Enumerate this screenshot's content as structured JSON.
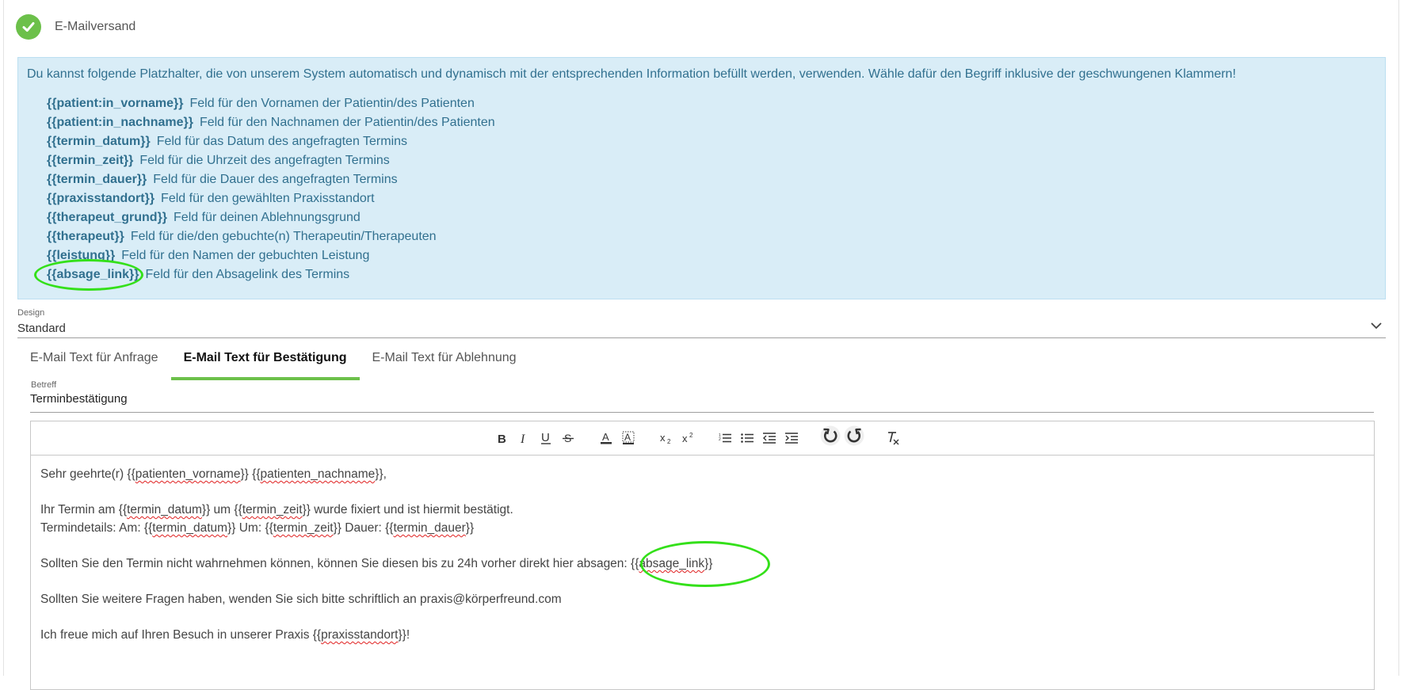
{
  "header": {
    "title": "E-Mailversand"
  },
  "info": {
    "intro": "Du kannst folgende Platzhalter, die von unserem System automatisch und dynamisch mit der entsprechenden Information befüllt werden, verwenden. Wähle dafür den Begriff inklusive der geschwungenen Klammern!",
    "placeholders": [
      {
        "key": "{{patient:in_vorname}}",
        "desc": "Feld für den Vornamen der Patientin/des Patienten"
      },
      {
        "key": "{{patient:in_nachname}}",
        "desc": "Feld für den Nachnamen der Patientin/des Patienten"
      },
      {
        "key": "{{termin_datum}}",
        "desc": "Feld für das Datum des angefragten Termins"
      },
      {
        "key": "{{termin_zeit}}",
        "desc": "Feld für die Uhrzeit des angefragten Termins"
      },
      {
        "key": "{{termin_dauer}}",
        "desc": "Feld für die Dauer des angefragten Termins"
      },
      {
        "key": "{{praxisstandort}}",
        "desc": "Feld für den gewählten Praxisstandort"
      },
      {
        "key": "{{therapeut_grund}}",
        "desc": "Feld für deinen Ablehnungsgrund"
      },
      {
        "key": "{{therapeut}}",
        "desc": "Feld für die/den gebuchte(n) Therapeutin/Therapeuten"
      },
      {
        "key": "{{leistung}}",
        "desc": "Feld für den Namen der gebuchten Leistung"
      },
      {
        "key": "{{absage_link}}",
        "desc": "Feld für den Absagelink des Termins"
      }
    ]
  },
  "design": {
    "label": "Design",
    "value": "Standard"
  },
  "tabs": [
    {
      "label": "E-Mail Text für Anfrage",
      "active": false
    },
    {
      "label": "E-Mail Text für Bestätigung",
      "active": true
    },
    {
      "label": "E-Mail Text für Ablehnung",
      "active": false
    }
  ],
  "betreff": {
    "label": "Betreff",
    "value": "Terminbestätigung"
  },
  "toolbar": {
    "icons": [
      "bold-icon",
      "italic-icon",
      "underline-icon",
      "strikethrough-icon",
      "text-color-icon",
      "highlight-icon",
      "subscript-icon",
      "superscript-icon",
      "ordered-list-icon",
      "bullet-list-icon",
      "outdent-icon",
      "indent-icon",
      "undo-icon",
      "redo-icon",
      "clear-format-icon"
    ]
  },
  "editor": {
    "l1a": "Sehr geehrte(r) {{",
    "l1b": "patienten_vorname",
    "l1c": "}} {{",
    "l1d": "patienten_nachname",
    "l1e": "}},",
    "l2a": "Ihr Termin am {{",
    "l2b": "termin_datum",
    "l2c": "}} um {{",
    "l2d": "termin_zeit",
    "l2e": "}} wurde fixiert und ist hiermit bestätigt.",
    "l3a": "Termindetails: Am: {{",
    "l3b": "termin_datum",
    "l3c": "}} Um: {{",
    "l3d": "termin_zeit",
    "l3e": "}} Dauer: {{",
    "l3f": "termin_dauer",
    "l3g": "}}",
    "l4a": "Sollten Sie den Termin nicht wahrnehmen können, können Sie diesen bis zu 24h vorher direkt hier absagen: {{",
    "l4b": "absage_link",
    "l4c": "}}",
    "l5": "Sollten Sie weitere Fragen haben, wenden Sie sich bitte schriftlich an praxis@körperfreund.com",
    "l6a": "Ich freue mich auf Ihren Besuch in unserer Praxis {{",
    "l6b": "praxisstandort",
    "l6c": "}}!"
  },
  "colors": {
    "accent_green": "#6cc04a",
    "info_bg": "#d9edf7",
    "info_text": "#31708f",
    "annotation": "#34e01a"
  }
}
